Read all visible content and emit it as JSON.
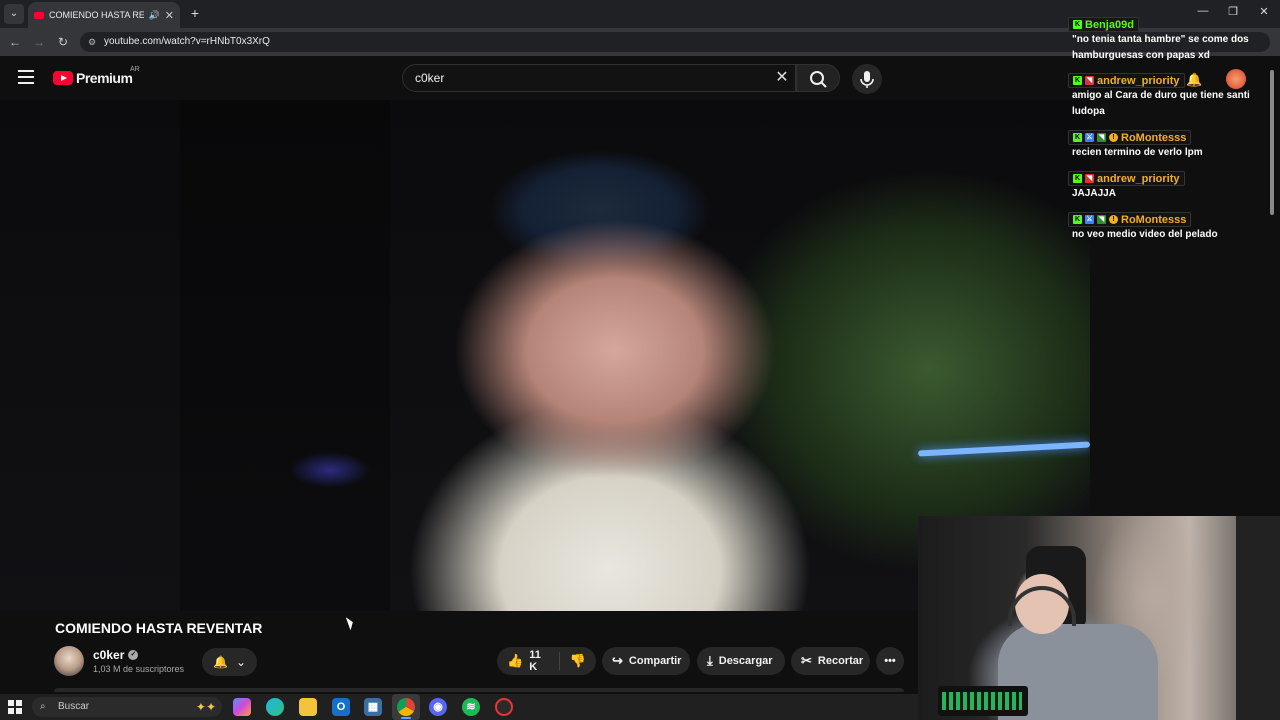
{
  "browser": {
    "tab_title": "COMIENDO HASTA REVENTAR",
    "url": "youtube.com/watch?v=rHNbT0x3XrQ"
  },
  "youtube": {
    "brand": "Premium",
    "country": "AR",
    "search_value": "c0ker"
  },
  "video": {
    "title": "COMIENDO HASTA REVENTAR",
    "channel": "c0ker",
    "subscribers": "1,03 M de suscriptores",
    "likes": "11 K",
    "share_label": "Compartir",
    "download_label": "Descargar",
    "clip_label": "Recortar"
  },
  "chat": {
    "messages": [
      {
        "user": "Benja09d",
        "user_color": "#53fc18",
        "text": "\"no tenia tanta hambre\" se come dos hamburguesas con papas xd"
      },
      {
        "user": "andrew_priority",
        "user_color": "#f2b01e",
        "text": "amigo al Cara de duro que tiene santi ludopa"
      },
      {
        "user": "RoMontesss",
        "user_color": "#f2b01e",
        "text": "recien termino de verlo lpm"
      },
      {
        "user": "andrew_priority",
        "user_color": "#f2b01e",
        "text": "JAJAJJA"
      },
      {
        "user": "RoMontesss",
        "user_color": "#f2b01e",
        "text": "no veo medio video del pelado"
      }
    ]
  },
  "taskbar": {
    "search_label": "Buscar"
  },
  "colors": {
    "youtube_red": "#ff0033",
    "kick_green": "#53fc18",
    "chat_name_gold": "#f2b01e",
    "background": "#0f0f0f"
  }
}
